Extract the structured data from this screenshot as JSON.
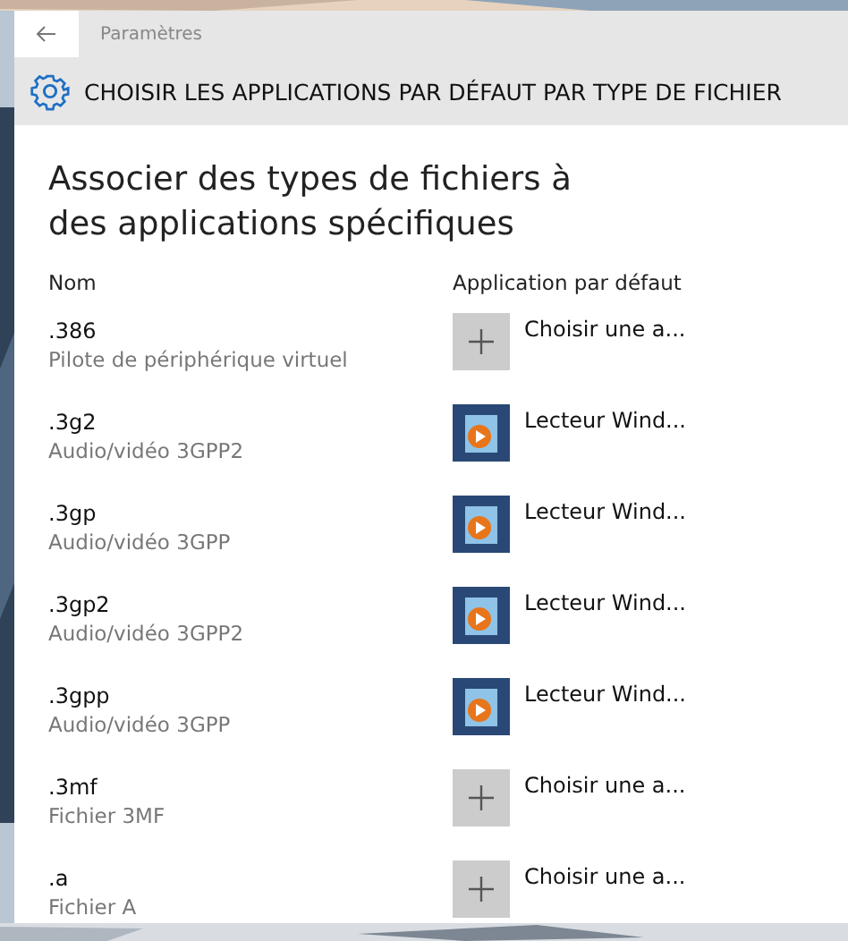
{
  "window": {
    "title": "Paramètres"
  },
  "header": {
    "title": "CHOISIR LES APPLICATIONS PAR DÉFAUT PAR TYPE DE FICHIER"
  },
  "heading": "Associer des types de fichiers à des applications spécifiques",
  "columns": [
    "Nom",
    "Application par défaut"
  ],
  "rows": [
    {
      "extension": ".386",
      "description": "Pilote de périphérique virtuel",
      "app": "Choisir une a...",
      "kind": "choose"
    },
    {
      "extension": ".3g2",
      "description": "Audio/vidéo 3GPP2",
      "app": "Lecteur Wind...",
      "kind": "media"
    },
    {
      "extension": ".3gp",
      "description": "Audio/vidéo 3GPP",
      "app": "Lecteur Wind...",
      "kind": "media"
    },
    {
      "extension": ".3gp2",
      "description": "Audio/vidéo 3GPP2",
      "app": "Lecteur Wind...",
      "kind": "media"
    },
    {
      "extension": ".3gpp",
      "description": "Audio/vidéo 3GPP",
      "app": "Lecteur Wind...",
      "kind": "media"
    },
    {
      "extension": ".3mf",
      "description": "Fichier 3MF",
      "app": "Choisir une a...",
      "kind": "choose"
    },
    {
      "extension": ".a",
      "description": "Fichier A",
      "app": "Choisir une a...",
      "kind": "choose"
    }
  ]
}
